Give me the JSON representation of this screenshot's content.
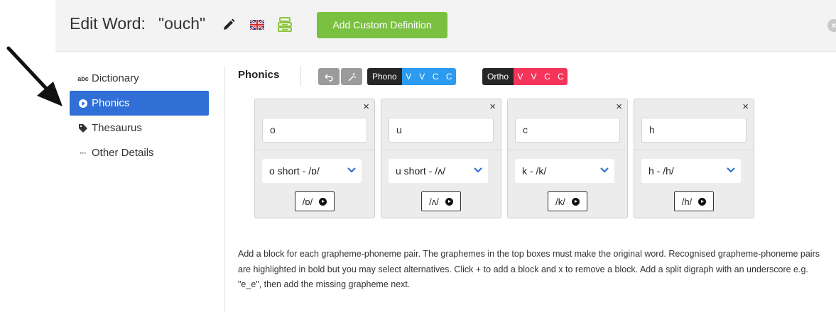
{
  "header": {
    "title_label": "Edit Word:",
    "word": "\"ouch\"",
    "icons": [
      "pencil-icon",
      "uk-flag-icon",
      "stack-icon"
    ],
    "add_custom_definition": "Add Custom Definition",
    "close_icon": "close-icon"
  },
  "sidebar": {
    "items": [
      {
        "icon": "abc-icon",
        "icon_text": "abc",
        "label": "Dictionary",
        "active": false
      },
      {
        "icon": "phonics-icon",
        "label": "Phonics",
        "active": true
      },
      {
        "icon": "tag-icon",
        "label": "Thesaurus",
        "active": false
      },
      {
        "icon": "ellipsis-icon",
        "icon_text": "···",
        "label": "Other Details",
        "active": false
      }
    ]
  },
  "phonics": {
    "title": "Phonics",
    "tools": [
      "undo-icon",
      "magic-wand-icon"
    ],
    "phono": {
      "label": "Phono",
      "codes": [
        "V",
        "V",
        "C",
        "C"
      ]
    },
    "ortho": {
      "label": "Ortho",
      "codes": [
        "V",
        "V",
        "C",
        "C"
      ]
    },
    "blocks": [
      {
        "grapheme": "o",
        "phoneme": "o short - /ɒ/",
        "sound": "/ɒ/"
      },
      {
        "grapheme": "u",
        "phoneme": "u short - /ʌ/",
        "sound": "/ʌ/"
      },
      {
        "grapheme": "c",
        "phoneme": "k - /k/",
        "sound": "/k/"
      },
      {
        "grapheme": "h",
        "phoneme": "h - /h/",
        "sound": "/h/"
      }
    ],
    "remove_glyph": "×",
    "help_text": "Add a block for each grapheme-phoneme pair. The graphemes in the top boxes must make the original word. Recognised grapheme-phoneme pairs are highlighted in bold but you may select alternatives. Click + to add a block and x to remove a block. Add a split digraph with an underscore e.g. \"e_e\", then add the missing grapheme next."
  },
  "colors": {
    "accent_blue": "#2f6fd6",
    "add_button_green": "#7ac142",
    "phono_blue": "#2b9bf0",
    "ortho_red": "#f5345a",
    "stack_icon_green": "#8cc63f"
  }
}
